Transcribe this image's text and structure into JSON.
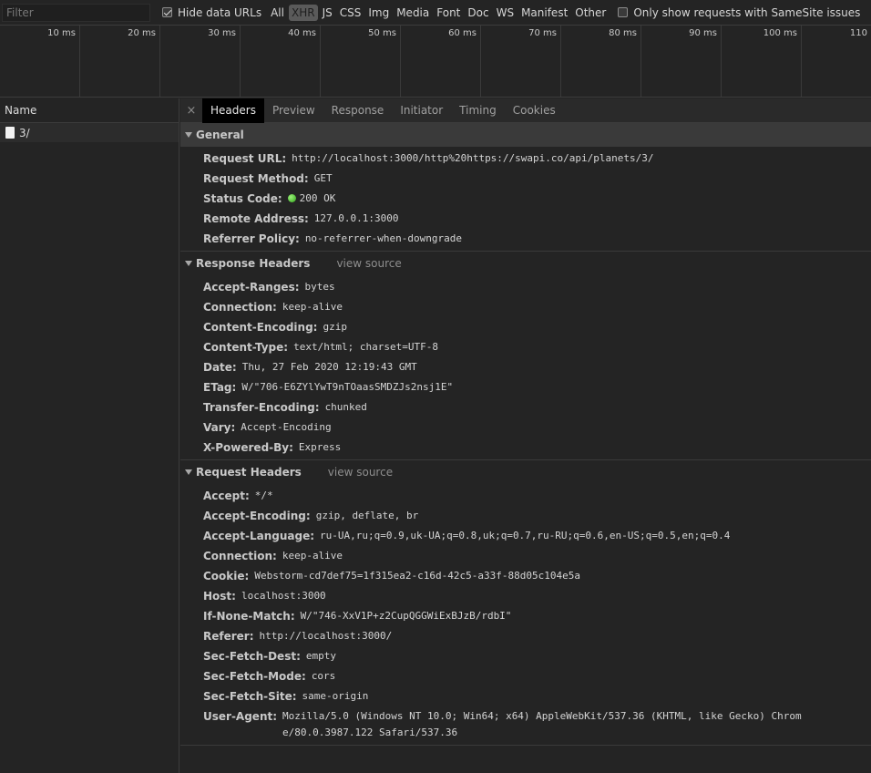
{
  "filter": {
    "placeholder": "Filter",
    "value": ""
  },
  "hide_data_urls": {
    "label": "Hide data URLs",
    "checked": true
  },
  "types": [
    "All",
    "XHR",
    "JS",
    "CSS",
    "Img",
    "Media",
    "Font",
    "Doc",
    "WS",
    "Manifest",
    "Other"
  ],
  "active_type": "XHR",
  "samesite": {
    "label": "Only show requests with SameSite issues",
    "checked": false
  },
  "timeline_ticks": [
    "10 ms",
    "20 ms",
    "30 ms",
    "40 ms",
    "50 ms",
    "60 ms",
    "70 ms",
    "80 ms",
    "90 ms",
    "100 ms",
    "110"
  ],
  "request_list": {
    "header": "Name",
    "items": [
      {
        "name": "3/",
        "icon": "document-icon"
      }
    ]
  },
  "detail_tabs": {
    "close": "×",
    "items": [
      "Headers",
      "Preview",
      "Response",
      "Initiator",
      "Timing",
      "Cookies"
    ],
    "active": "Headers"
  },
  "general": {
    "title": "General",
    "rows": [
      {
        "key": "Request URL:",
        "value": "http://localhost:3000/http%20https://swapi.co/api/planets/3/"
      },
      {
        "key": "Request Method:",
        "value": "GET"
      },
      {
        "key": "Status Code:",
        "value": "200 OK",
        "status_color": "#3cbf26"
      },
      {
        "key": "Remote Address:",
        "value": "127.0.0.1:3000"
      },
      {
        "key": "Referrer Policy:",
        "value": "no-referrer-when-downgrade"
      }
    ]
  },
  "response_headers": {
    "title": "Response Headers",
    "view_source": "view source",
    "rows": [
      {
        "key": "Accept-Ranges:",
        "value": "bytes"
      },
      {
        "key": "Connection:",
        "value": "keep-alive"
      },
      {
        "key": "Content-Encoding:",
        "value": "gzip"
      },
      {
        "key": "Content-Type:",
        "value": "text/html; charset=UTF-8"
      },
      {
        "key": "Date:",
        "value": "Thu, 27 Feb 2020 12:19:43 GMT"
      },
      {
        "key": "ETag:",
        "value": "W/\"706-E6ZYlYwT9nTOaasSMDZJs2nsj1E\""
      },
      {
        "key": "Transfer-Encoding:",
        "value": "chunked"
      },
      {
        "key": "Vary:",
        "value": "Accept-Encoding"
      },
      {
        "key": "X-Powered-By:",
        "value": "Express"
      }
    ]
  },
  "request_headers": {
    "title": "Request Headers",
    "view_source": "view source",
    "rows": [
      {
        "key": "Accept:",
        "value": "*/*"
      },
      {
        "key": "Accept-Encoding:",
        "value": "gzip, deflate, br"
      },
      {
        "key": "Accept-Language:",
        "value": "ru-UA,ru;q=0.9,uk-UA;q=0.8,uk;q=0.7,ru-RU;q=0.6,en-US;q=0.5,en;q=0.4"
      },
      {
        "key": "Connection:",
        "value": "keep-alive"
      },
      {
        "key": "Cookie:",
        "value": "Webstorm-cd7def75=1f315ea2-c16d-42c5-a33f-88d05c104e5a"
      },
      {
        "key": "Host:",
        "value": "localhost:3000"
      },
      {
        "key": "If-None-Match:",
        "value": "W/\"746-XxV1P+z2CupQGGWiExBJzB/rdbI\""
      },
      {
        "key": "Referer:",
        "value": "http://localhost:3000/"
      },
      {
        "key": "Sec-Fetch-Dest:",
        "value": "empty"
      },
      {
        "key": "Sec-Fetch-Mode:",
        "value": "cors"
      },
      {
        "key": "Sec-Fetch-Site:",
        "value": "same-origin"
      },
      {
        "key": "User-Agent:",
        "value": "Mozilla/5.0 (Windows NT 10.0; Win64; x64) AppleWebKit/537.36 (KHTML, like Gecko) Chrome/80.0.3987.122 Safari/537.36"
      }
    ]
  }
}
